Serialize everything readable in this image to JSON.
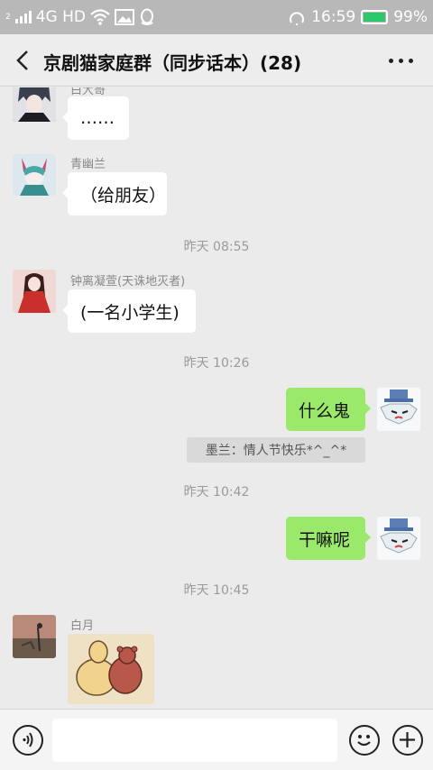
{
  "status_bar": {
    "sim": "2",
    "network": "4G HD",
    "time": "16:59",
    "battery": "99%",
    "battery_level": 0.99
  },
  "header": {
    "title": "京剧猫家庭群（同步话本）(28)"
  },
  "messages": [
    {
      "sender": "白大哥",
      "text": "……"
    },
    {
      "sender": "青幽兰",
      "text": "（给朋友）"
    },
    {
      "sender": "钟离凝萱(天诛地灭者)",
      "text": "(一名小学生)"
    },
    {
      "text": "什么鬼"
    },
    {
      "text": "干嘛呢"
    },
    {
      "sender": "白月"
    }
  ],
  "timestamps": [
    "昨天 08:55",
    "昨天 10:26",
    "昨天 10:42",
    "昨天 10:45"
  ],
  "notice": "墨兰：情人节快乐*^_^*",
  "input": {
    "placeholder": ""
  },
  "colors": {
    "background": "#ebebeb",
    "outgoing_bubble": "#9ae96a",
    "incoming_bubble": "#ffffff",
    "status_bar": "#b8b8b8",
    "battery": "#2fc76b"
  },
  "icons": [
    "signal-icon",
    "wifi-icon",
    "gallery-icon",
    "qq-icon",
    "alarm-icon",
    "battery-icon",
    "back-icon",
    "more-icon",
    "voice-icon",
    "emoji-icon",
    "plus-icon"
  ]
}
